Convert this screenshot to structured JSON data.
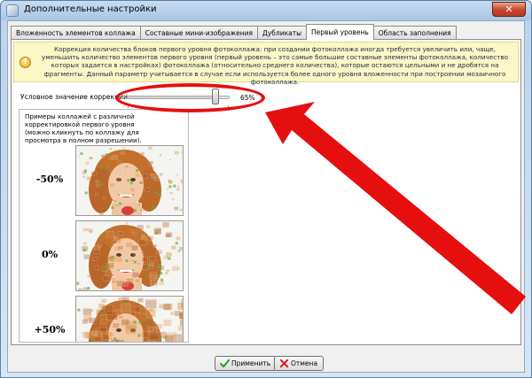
{
  "window": {
    "title": "Дополнительные настройки"
  },
  "tabs": [
    {
      "label": "Вложенность элементов коллажа"
    },
    {
      "label": "Составные мини-изображения"
    },
    {
      "label": "Дубликаты"
    },
    {
      "label": "Первый уровень",
      "active": true
    },
    {
      "label": "Область заполнения"
    }
  ],
  "info": {
    "text": "Коррекция количества блоков первого уровня фотоколлажа: при создании фотоколлажа иногда требуется увеличить или, чаще, уменьшить количество элементов первого уровня (первый уровень – это самые большие составные элементы фотоколлажа, количество которых задается в настройках) фотоколлажа (относительно среднего количества), которые остаются цельными и не дробятся на фрагменты. Данный параметр учитывается в случае если используется более одного уровня вложенности при построении мозаичного фотоколлажа."
  },
  "slider": {
    "label": "Условное значение коррекции:",
    "value_text": "65%",
    "fraction": 0.86
  },
  "preview": {
    "caption": "Примеры коллажей с различной корректировкой первого уровня (можно кликнуть по коллажу для просмотра в полном разрешении).",
    "items": [
      {
        "label": "-50%"
      },
      {
        "label": "0%"
      },
      {
        "label": "+50%"
      }
    ]
  },
  "footer": {
    "apply_label": "Применить",
    "cancel_label": "Отмена"
  },
  "colors": {
    "annotation": "#e60f0f",
    "info_bg": "#fbf8c6",
    "titlebar": "#a9c6e4"
  },
  "icons": {
    "apply": "check-icon",
    "cancel": "x-icon",
    "close": "close-icon",
    "info": "info-icon"
  }
}
